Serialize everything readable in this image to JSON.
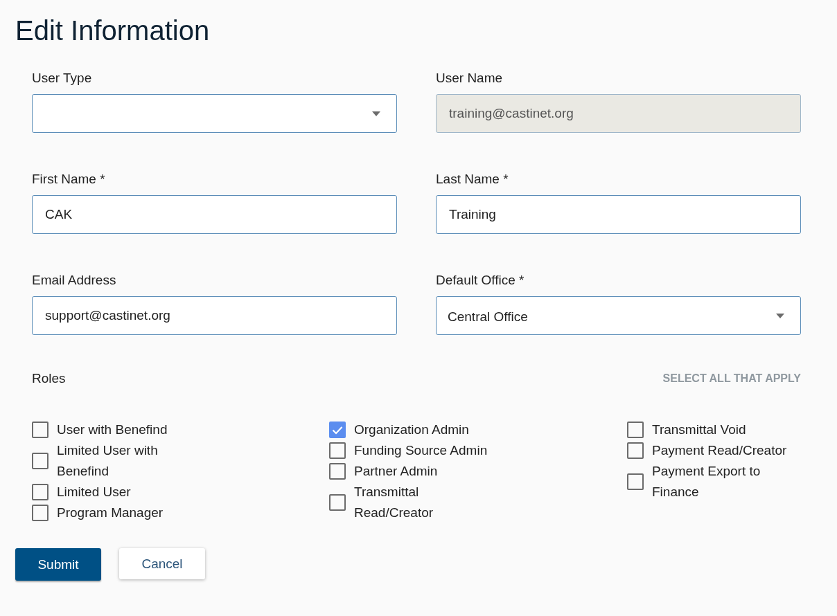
{
  "title": "Edit Information",
  "fields": [
    {
      "label": "User Type",
      "kind": "select",
      "disabled": false
    },
    {
      "label": "User Name",
      "kind": "text",
      "value": "training@castinet.org",
      "disabled": true
    },
    {
      "label": "First Name *",
      "kind": "text",
      "value": "CAK",
      "disabled": false
    },
    {
      "label": "Last Name *",
      "kind": "text",
      "value": "Training",
      "disabled": false
    },
    {
      "label": "Email Address",
      "kind": "text",
      "value": "support@castinet.org",
      "disabled": false
    },
    {
      "label": "Default Office *",
      "kind": "select",
      "value": "Central Office",
      "disabled": false
    }
  ],
  "roles": {
    "label": "Roles",
    "hint": "SELECT ALL THAT APPLY",
    "columns": [
      [
        {
          "label": "User with Benefind",
          "checked": false
        },
        {
          "label": "Limited User with Benefind",
          "checked": false
        },
        {
          "label": "Limited User",
          "checked": false
        },
        {
          "label": "Program Manager",
          "checked": false
        }
      ],
      [
        {
          "label": "Organization Admin",
          "checked": true
        },
        {
          "label": "Funding Source Admin",
          "checked": false
        },
        {
          "label": "Partner Admin",
          "checked": false
        },
        {
          "label": "Transmittal Read/Creator",
          "checked": false
        }
      ],
      [
        {
          "label": "Transmittal Void",
          "checked": false
        },
        {
          "label": "Payment Read/Creator",
          "checked": false
        },
        {
          "label": "Payment Export to Finance",
          "checked": false
        }
      ]
    ]
  },
  "buttons": {
    "submit": "Submit",
    "cancel": "Cancel"
  }
}
